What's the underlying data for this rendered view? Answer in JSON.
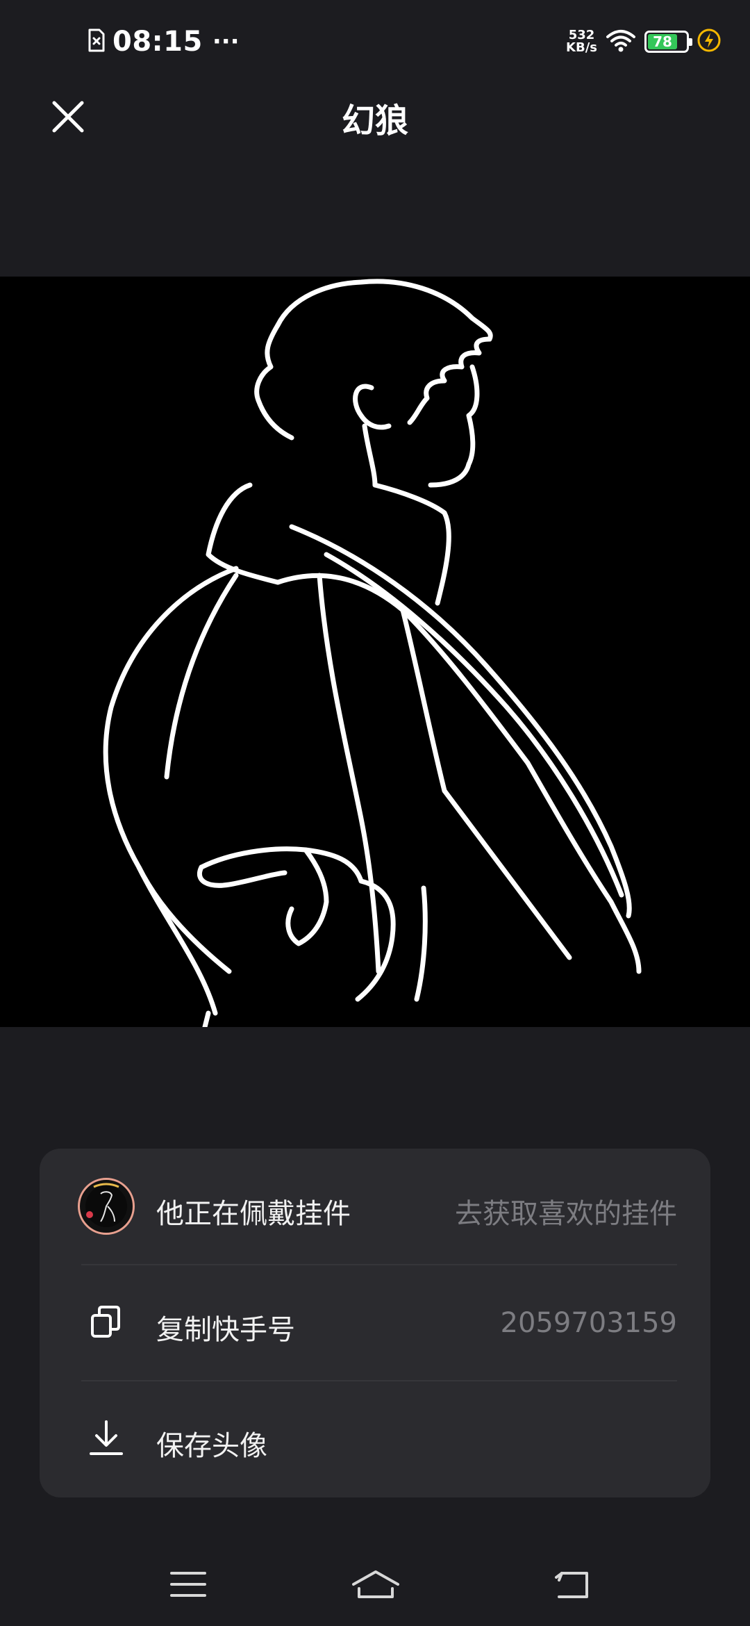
{
  "status_bar": {
    "time": "08:15",
    "more_indicator": "···",
    "net_speed_value": "532",
    "net_speed_unit": "KB/s",
    "battery_level": "78",
    "icons": [
      "sim-card-icon",
      "wifi-icon",
      "battery-icon",
      "charging-icon"
    ],
    "battery_color": "#34c759",
    "charging_color": "#f5b800"
  },
  "header": {
    "title": "幻狼",
    "close_icon": "close-icon"
  },
  "avatar": {
    "background": "#000000"
  },
  "actions": [
    {
      "label": "他正在佩戴挂件",
      "value": "去获取喜欢的挂件",
      "icon": "pendant-avatar-icon"
    },
    {
      "label": "复制快手号",
      "value": "2059703159",
      "icon": "copy-icon"
    },
    {
      "label": "保存头像",
      "value": "",
      "icon": "download-icon"
    }
  ],
  "nav_bar": {
    "icons": [
      "menu-icon",
      "home-icon",
      "back-icon"
    ]
  }
}
